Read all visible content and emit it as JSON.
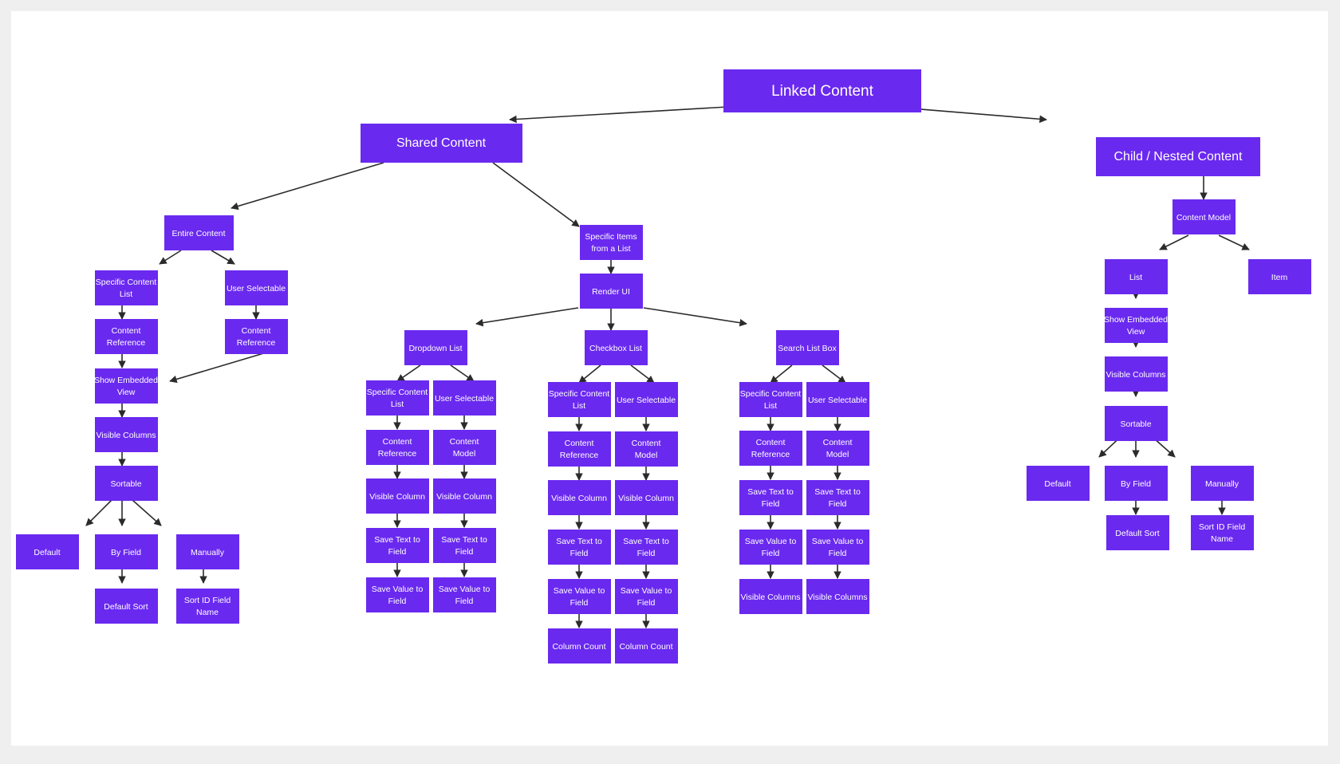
{
  "canvas": {
    "background": "#ffffff",
    "page_background": "#efefef",
    "node_color": "#6a29ef",
    "node_text_color": "#ffffff",
    "edge_color": "#2b2b2b"
  },
  "diagram": {
    "type": "flowchart",
    "title": "Linked Content",
    "nodes": {
      "root": {
        "label": "Linked Content"
      },
      "shared": {
        "label": "Shared Content"
      },
      "child_nested": {
        "label": "Child / Nested Content"
      },
      "entire_content": {
        "label": "Entire Content"
      },
      "ec_specific_content_list": {
        "label": "Specific Content List"
      },
      "ec_user_selectable": {
        "label": "User Selectable"
      },
      "ec_content_reference_a": {
        "label": "Content Reference"
      },
      "ec_content_reference_b": {
        "label": "Content Reference"
      },
      "ec_show_embedded_view": {
        "label": "Show Embedded View"
      },
      "ec_visible_columns": {
        "label": "Visible Columns"
      },
      "ec_sortable": {
        "label": "Sortable"
      },
      "ec_default": {
        "label": "Default"
      },
      "ec_by_field": {
        "label": "By Field"
      },
      "ec_manually": {
        "label": "Manually"
      },
      "ec_default_sort": {
        "label": "Default Sort"
      },
      "ec_sort_id_field_name": {
        "label": "Sort ID Field Name"
      },
      "specific_items": {
        "label": "Specific Items from a List"
      },
      "render_ui": {
        "label": "Render UI"
      },
      "dropdown_list": {
        "label": "Dropdown List"
      },
      "dd_specific_content_list": {
        "label": "Specific Content List"
      },
      "dd_user_selectable": {
        "label": "User Selectable"
      },
      "dd_content_reference": {
        "label": "Content Reference"
      },
      "dd_content_model": {
        "label": "Content Model"
      },
      "dd_visible_column_a": {
        "label": "Visible Column"
      },
      "dd_visible_column_b": {
        "label": "Visible Column"
      },
      "dd_save_text_a": {
        "label": "Save Text to Field"
      },
      "dd_save_text_b": {
        "label": "Save Text to Field"
      },
      "dd_save_value_a": {
        "label": "Save Value to Field"
      },
      "dd_save_value_b": {
        "label": "Save Value to Field"
      },
      "checkbox_list": {
        "label": "Checkbox List"
      },
      "cb_specific_content_list": {
        "label": "Specific Content List"
      },
      "cb_user_selectable": {
        "label": "User Selectable"
      },
      "cb_content_reference": {
        "label": "Content Reference"
      },
      "cb_content_model": {
        "label": "Content Model"
      },
      "cb_visible_column_a": {
        "label": "Visible Column"
      },
      "cb_visible_column_b": {
        "label": "Visible Column"
      },
      "cb_save_text_a": {
        "label": "Save Text to Field"
      },
      "cb_save_text_b": {
        "label": "Save Text to Field"
      },
      "cb_save_value_a": {
        "label": "Save Value to Field"
      },
      "cb_save_value_b": {
        "label": "Save Value to Field"
      },
      "cb_column_count_a": {
        "label": "Column Count"
      },
      "cb_column_count_b": {
        "label": "Column Count"
      },
      "search_list_box": {
        "label": "Search List Box"
      },
      "sb_specific_content_list": {
        "label": "Specific Content List"
      },
      "sb_user_selectable": {
        "label": "User Selectable"
      },
      "sb_content_reference": {
        "label": "Content Reference"
      },
      "sb_content_model": {
        "label": "Content Model"
      },
      "sb_save_text_a": {
        "label": "Save Text to Field"
      },
      "sb_save_text_b": {
        "label": "Save Text to Field"
      },
      "sb_save_value_a": {
        "label": "Save Value to Field"
      },
      "sb_save_value_b": {
        "label": "Save Value to Field"
      },
      "sb_visible_columns_a": {
        "label": "Visible Columns"
      },
      "sb_visible_columns_b": {
        "label": "Visible Columns"
      },
      "cn_content_model": {
        "label": "Content Model"
      },
      "cn_list": {
        "label": "List"
      },
      "cn_item": {
        "label": "Item"
      },
      "cn_show_embedded_view": {
        "label": "Show Embedded View"
      },
      "cn_visible_columns": {
        "label": "Visible Columns"
      },
      "cn_sortable": {
        "label": "Sortable"
      },
      "cn_default": {
        "label": "Default"
      },
      "cn_by_field": {
        "label": "By Field"
      },
      "cn_manually": {
        "label": "Manually"
      },
      "cn_default_sort": {
        "label": "Default Sort"
      },
      "cn_sort_id_field_name": {
        "label": "Sort ID Field Name"
      }
    }
  }
}
